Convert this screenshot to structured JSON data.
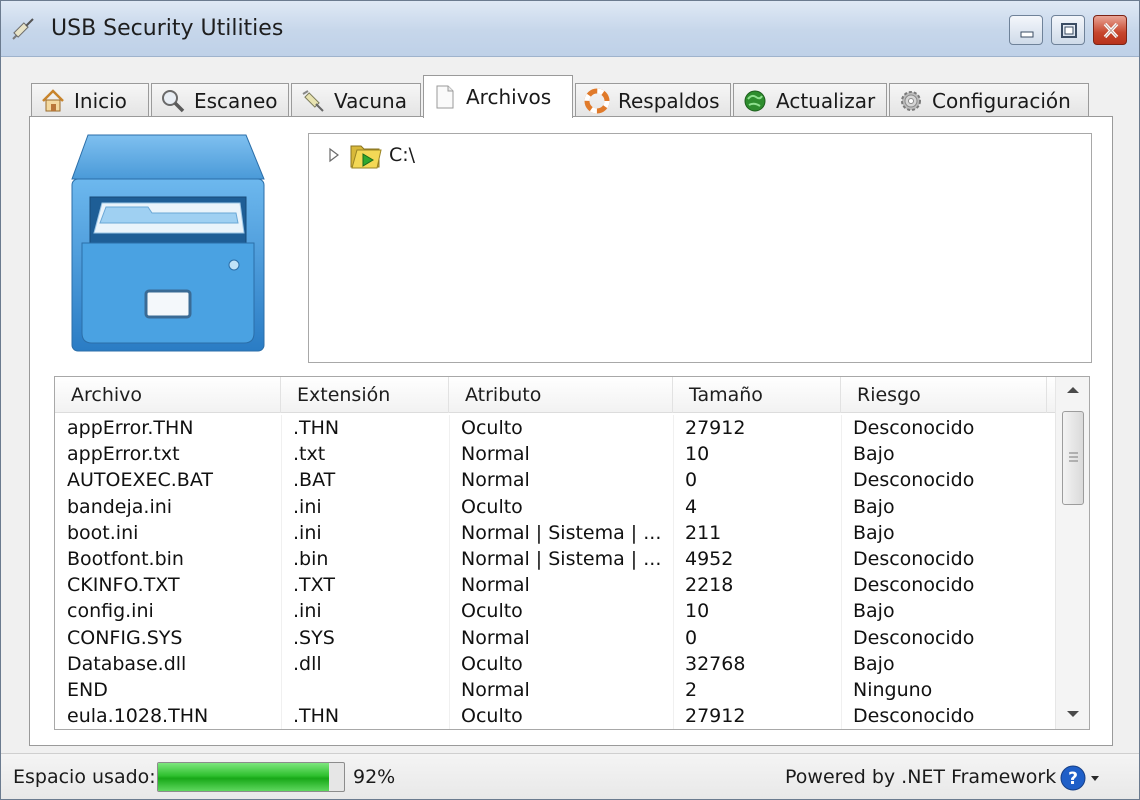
{
  "window": {
    "title": "USB Security Utilities"
  },
  "tabs": [
    {
      "label": "Inicio",
      "icon": "home-icon"
    },
    {
      "label": "Escaneo",
      "icon": "magnifier-icon"
    },
    {
      "label": "Vacuna",
      "icon": "syringe-icon"
    },
    {
      "label": "Archivos",
      "icon": "document-icon",
      "active": true
    },
    {
      "label": "Respaldos",
      "icon": "lifebuoy-icon"
    },
    {
      "label": "Actualizar",
      "icon": "globe-update-icon"
    },
    {
      "label": "Configuración",
      "icon": "gear-icon"
    }
  ],
  "tree": {
    "root_label": "C:\\",
    "expanded": false
  },
  "listview": {
    "columns": [
      "Archivo",
      "Extensión",
      "Atributo",
      "Tamaño",
      "Riesgo"
    ],
    "rows": [
      [
        "appError.THN",
        ".THN",
        "Oculto",
        "27912",
        "Desconocido"
      ],
      [
        "appError.txt",
        ".txt",
        "Normal",
        "10",
        "Bajo"
      ],
      [
        "AUTOEXEC.BAT",
        ".BAT",
        "Normal",
        "0",
        "Desconocido"
      ],
      [
        "bandeja.ini",
        ".ini",
        "Oculto",
        "4",
        "Bajo"
      ],
      [
        "boot.ini",
        ".ini",
        "Normal | Sistema | ...",
        "211",
        "Bajo"
      ],
      [
        "Bootfont.bin",
        ".bin",
        "Normal | Sistema | ...",
        "4952",
        "Desconocido"
      ],
      [
        "CKINFO.TXT",
        ".TXT",
        "Normal",
        "2218",
        "Desconocido"
      ],
      [
        "config.ini",
        ".ini",
        "Oculto",
        "10",
        "Bajo"
      ],
      [
        "CONFIG.SYS",
        ".SYS",
        "Normal",
        "0",
        "Desconocido"
      ],
      [
        "Database.dll",
        ".dll",
        "Oculto",
        "32768",
        "Bajo"
      ],
      [
        "END",
        "",
        "Normal",
        "2",
        "Ninguno"
      ],
      [
        "eula.1028.THN",
        ".THN",
        "Oculto",
        "27912",
        "Desconocido"
      ]
    ]
  },
  "status": {
    "space_label": "Espacio usado:",
    "space_percent_text": "92%",
    "space_fraction": 0.92,
    "powered_by": "Powered by .NET Framework"
  },
  "colors": {
    "progress_green": "#2fc12f",
    "help_blue": "#1f5fc8",
    "close_red": "#c6452c"
  }
}
